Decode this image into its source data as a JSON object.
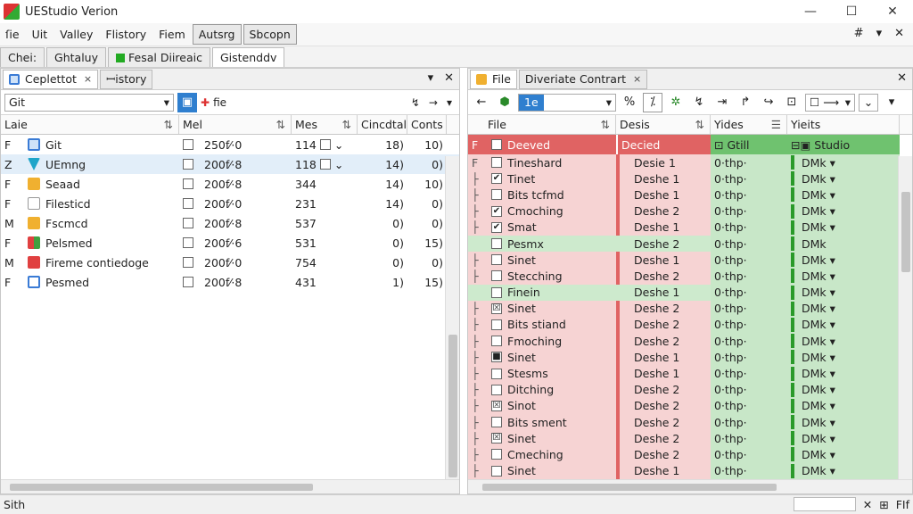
{
  "window": {
    "title": "UEStudio Verion",
    "controls": [
      "—",
      "☐",
      "✕"
    ]
  },
  "menu": {
    "items": [
      "ſie",
      "Uit",
      "Valley",
      "Flistory",
      "Fiem",
      "Autsrg",
      "Sbcopn"
    ],
    "boxed": [
      5,
      6
    ],
    "right_icons": [
      "#",
      "▾",
      "✕"
    ]
  },
  "doc_tabs": [
    {
      "label": "Chei:",
      "active": false
    },
    {
      "label": "Ghtaluy",
      "active": false
    },
    {
      "label": "Fesal Diireaic",
      "active": false,
      "icon": true
    },
    {
      "label": "Gistenddv",
      "active": true
    }
  ],
  "left": {
    "tabs": [
      {
        "label": "Ceplettot",
        "close": "×"
      },
      {
        "label": "ꟷistory",
        "close": ""
      }
    ],
    "ctrls": [
      "▾",
      "✕"
    ],
    "toolbar": {
      "combo": "Git",
      "file_label": "fie",
      "icons": [
        "↯",
        "→",
        "▾"
      ]
    },
    "headers": [
      "Laie",
      "Mel",
      "Mes",
      "Cincdtal",
      "Conts"
    ],
    "header_sorts": [
      "⇅",
      "⇅",
      "⇅",
      "",
      ""
    ],
    "rows": [
      {
        "mark": "F",
        "icon": "git",
        "name": "Git",
        "date": "250f⁄·0",
        "mes": "114",
        "a": "18)",
        "b": "10)",
        "sel": false
      },
      {
        "mark": "Z",
        "icon": "tri",
        "name": "UEmng",
        "date": "200f⁄·8",
        "mes": "118",
        "a": "14)",
        "b": "0)",
        "sel": true
      },
      {
        "mark": "F",
        "icon": "box",
        "name": "Seaad",
        "date": "200f⁄·8",
        "mes": "344",
        "a": "14)",
        "b": "10)",
        "sel": false
      },
      {
        "mark": "F",
        "icon": "doc",
        "name": "Filesticd",
        "date": "200f⁄·0",
        "mes": "231",
        "a": "14)",
        "b": "0)",
        "sel": false
      },
      {
        "mark": "M",
        "icon": "box",
        "name": "Fscmcd",
        "date": "200f⁄·8",
        "mes": "537",
        "a": "0)",
        "b": "0)",
        "sel": false
      },
      {
        "mark": "F",
        "icon": "mix",
        "name": "Pelsmed",
        "date": "200f⁄·6",
        "mes": "531",
        "a": "0)",
        "b": "15)",
        "sel": false
      },
      {
        "mark": "M",
        "icon": "red",
        "name": "Fireme contiedoge",
        "date": "200f⁄·0",
        "mes": "754",
        "a": "0)",
        "b": "0)",
        "sel": false
      },
      {
        "mark": "F",
        "icon": "blue",
        "name": "Pesmed",
        "date": "200f⁄·8",
        "mes": "431",
        "a": "1)",
        "b": "15)",
        "sel": false
      }
    ]
  },
  "right": {
    "tabs": [
      {
        "label": "File",
        "close": ""
      },
      {
        "label": "Diveriate Contrart",
        "close": "×"
      }
    ],
    "ctrls": [
      "✕"
    ],
    "toolbar": {
      "combo": "1e",
      "icons": [
        "%",
        "⁒",
        "✲",
        "↯",
        "⇥",
        "↱",
        "↪",
        "⊡"
      ],
      "tail": "▾"
    },
    "headers": [
      "File",
      "Desis",
      "Yides",
      "Yieits"
    ],
    "head_row": {
      "file": "Deeved",
      "desis": "Decied",
      "yides": "Gtill",
      "yieits": "Studio"
    },
    "rows": [
      {
        "mark": "F",
        "name": "Tineshard",
        "desis": "Desie 1",
        "yides": "0·thp·",
        "yieits": "DMk ▾",
        "bg": "red",
        "check": ""
      },
      {
        "mark": "├",
        "name": "Tinet",
        "desis": "Deshe 1",
        "yides": "0·thp·",
        "yieits": "DMk ▾",
        "bg": "red",
        "check": "✔"
      },
      {
        "mark": "├",
        "name": "Bits tcfmd",
        "desis": "Deshe 1",
        "yides": "0·thp·",
        "yieits": "DMk ▾",
        "bg": "red",
        "check": ""
      },
      {
        "mark": "├",
        "name": "Cmoching",
        "desis": "Deshe 2",
        "yides": "0·thp·",
        "yieits": "DMk ▾",
        "bg": "red",
        "check": "✔"
      },
      {
        "mark": "├",
        "name": "Smat",
        "desis": "Deshe 1",
        "yides": "0·thp·",
        "yieits": "DMk ▾",
        "bg": "red",
        "check": "✔"
      },
      {
        "mark": "",
        "name": "Pesmx",
        "desis": "Deshe 2",
        "yides": "0·thp·",
        "yieits": "DMk",
        "bg": "green",
        "check": ""
      },
      {
        "mark": "├",
        "name": "Sinet",
        "desis": "Deshe 1",
        "yides": "0·thp·",
        "yieits": "DMk ▾",
        "bg": "red",
        "check": ""
      },
      {
        "mark": "├",
        "name": "Stecching",
        "desis": "Deshe 2",
        "yides": "0·thp·",
        "yieits": "DMk ▾",
        "bg": "red",
        "check": ""
      },
      {
        "mark": "",
        "name": "Finein",
        "desis": "Deshe 1",
        "yides": "0·thp·",
        "yieits": "DMk ▾",
        "bg": "green",
        "check": ""
      },
      {
        "mark": "├",
        "name": "Sinet",
        "desis": "Deshe 2",
        "yides": "0·thp·",
        "yieits": "DMk ▾",
        "bg": "red",
        "check": "☒"
      },
      {
        "mark": "├",
        "name": "Bits stiand",
        "desis": "Deshe 2",
        "yides": "0·thp·",
        "yieits": "DMk ▾",
        "bg": "red",
        "check": ""
      },
      {
        "mark": "├",
        "name": "Fmoching",
        "desis": "Deshe 2",
        "yides": "0·thp·",
        "yieits": "DMk ▾",
        "bg": "red",
        "check": ""
      },
      {
        "mark": "├",
        "name": "Sinet",
        "desis": "Deshe 1",
        "yides": "0·thp·",
        "yieits": "DMk ▾",
        "bg": "red",
        "check": "■"
      },
      {
        "mark": "├",
        "name": "Stesms",
        "desis": "Deshe 1",
        "yides": "0·thp·",
        "yieits": "DMk ▾",
        "bg": "red",
        "check": ""
      },
      {
        "mark": "├",
        "name": "Ditching",
        "desis": "Deshe 2",
        "yides": "0·thp·",
        "yieits": "DMk ▾",
        "bg": "red",
        "check": ""
      },
      {
        "mark": "├",
        "name": "Sinot",
        "desis": "Deshe 2",
        "yides": "0·thp·",
        "yieits": "DMk ▾",
        "bg": "red",
        "check": "☒"
      },
      {
        "mark": "├",
        "name": "Bits sment",
        "desis": "Deshe 2",
        "yides": "0·thp·",
        "yieits": "DMk ▾",
        "bg": "red",
        "check": ""
      },
      {
        "mark": "├",
        "name": "Sinet",
        "desis": "Deshe 2",
        "yides": "0·thp·",
        "yieits": "DMk ▾",
        "bg": "red",
        "check": "☒"
      },
      {
        "mark": "├",
        "name": "Cmeching",
        "desis": "Deshe 2",
        "yides": "0·thp·",
        "yieits": "DMk ▾",
        "bg": "red",
        "check": ""
      },
      {
        "mark": "├",
        "name": "Sinet",
        "desis": "Deshe 1",
        "yides": "0·thp·",
        "yieits": "DMk ▾",
        "bg": "red",
        "check": ""
      }
    ]
  },
  "status": {
    "text": "Sith",
    "right_label": "FIf"
  },
  "colors": {
    "red_head": "#e06363",
    "red_row": "#f4cfcf",
    "green_row": "#cdeacd",
    "green_head": "#6fc26f",
    "accent": "#2f7fcf"
  }
}
